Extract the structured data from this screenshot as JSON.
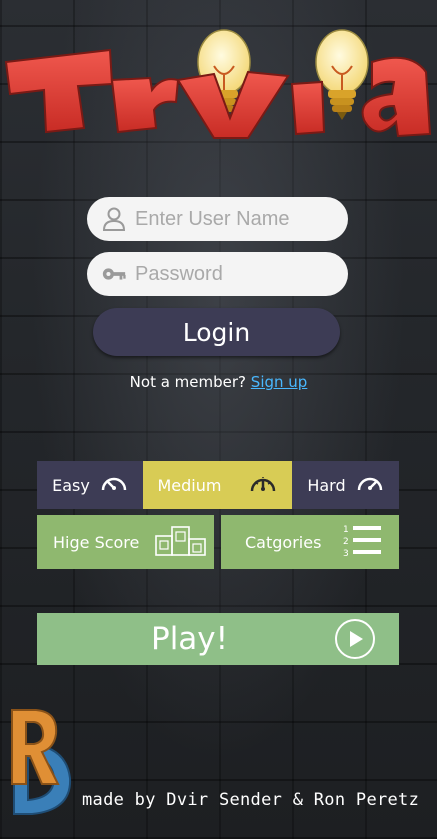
{
  "logo": {
    "text": "Trivia"
  },
  "login_form": {
    "username_placeholder": "Enter User Name",
    "password_placeholder": "Password",
    "login_label": "Login",
    "not_member_text": "Not a member?",
    "signup_label": "Sign up"
  },
  "difficulty": {
    "easy_label": "Easy",
    "medium_label": "Medium",
    "hard_label": "Hard",
    "selected": "Medium"
  },
  "menu": {
    "high_score_label": "Hige Score",
    "categories_label": "Catgories",
    "play_label": "Play!"
  },
  "footer": {
    "credit": "made by Dvir Sender & Ron Peretz",
    "logo_letters": "RD"
  },
  "colors": {
    "input_bg": "#f4f4f4",
    "login_bg": "#3d3c55",
    "difficulty_bg": "#3d3c55",
    "difficulty_selected": "#d8cc55",
    "menu_green": "#8fb86f",
    "play_green": "#8fbf88",
    "link_blue": "#49b8ff",
    "logo_red": "#e0423a"
  }
}
